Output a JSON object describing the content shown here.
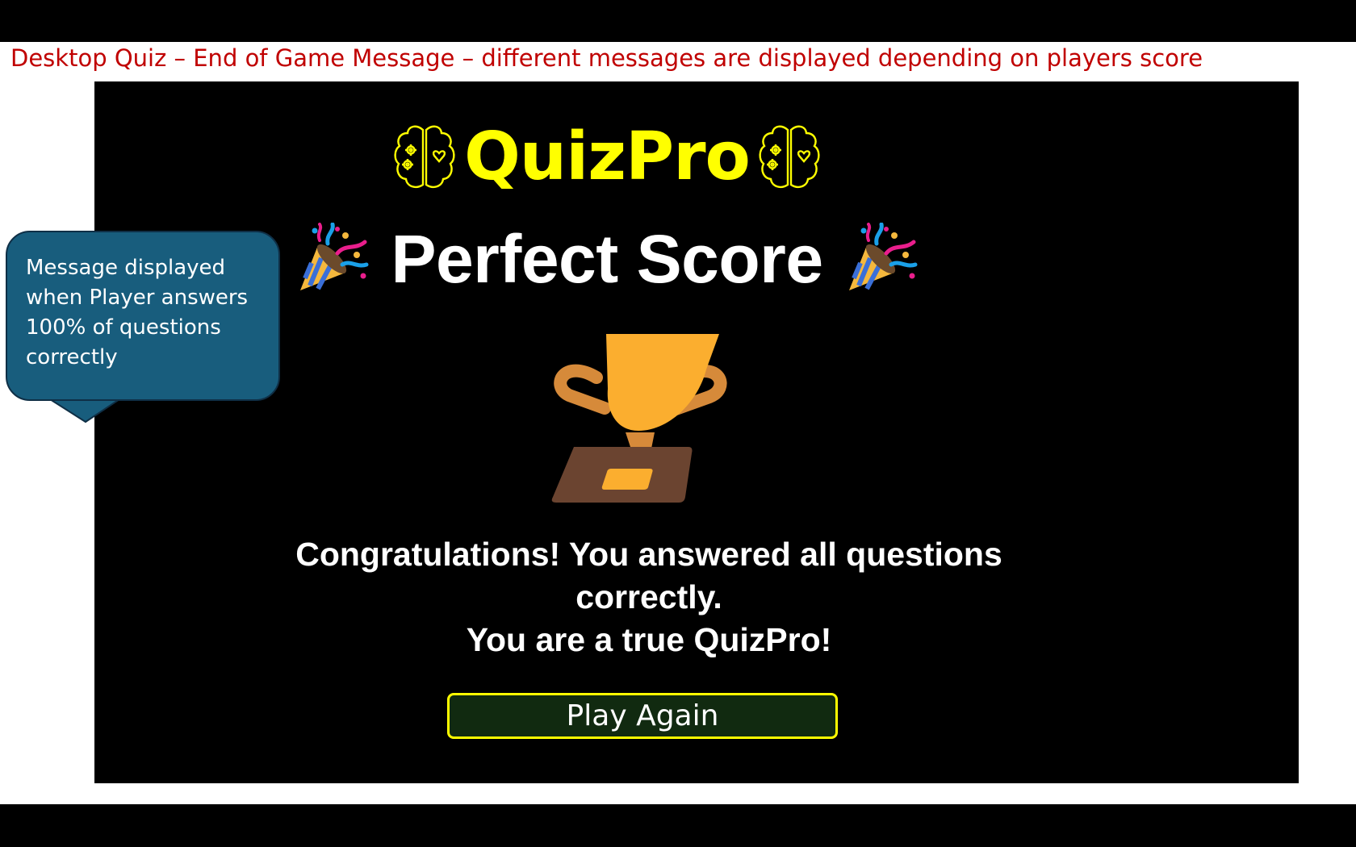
{
  "slide": {
    "caption": "Desktop Quiz – End of Game Message – different messages are displayed depending on players score",
    "caption_color": "#c00000"
  },
  "app": {
    "brand": "QuizPro",
    "brand_color": "#ffff00",
    "brand_icon": "brain-icon",
    "headline": "Perfect Score",
    "headline_icon": "party-popper-icon",
    "trophy_icon": "trophy-icon",
    "message_line_1": "Congratulations! You answered all questions correctly.",
    "message_line_2": "You are a true QuizPro!",
    "play_again_label": "Play Again",
    "button_bg": "#112a10",
    "button_border": "#ffff00"
  },
  "callout": {
    "text": "Message displayed when Player answers 100% of questions correctly",
    "bg_color": "#185d7d"
  }
}
